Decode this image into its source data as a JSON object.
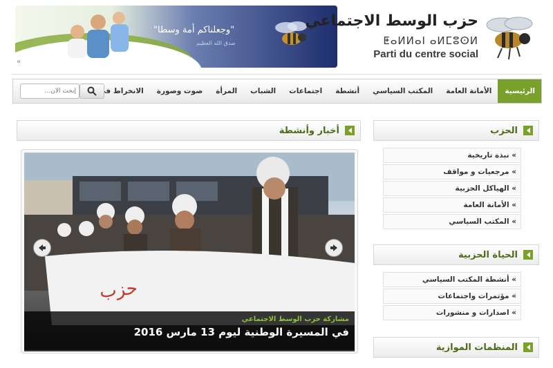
{
  "header": {
    "banner_quote": "\"وجعلناكم أمة وسطا\"",
    "banner_quote_source": "صدق الله العظيم",
    "banner_chevron": "«",
    "logo_arabic": "حزب الوسط الاجتماعي",
    "logo_tifinagh": "ⵟⴰⵍⵍⴰⵏ ⴰⵍⵎⵓⵙⵍ",
    "logo_french": "Parti du centre social"
  },
  "nav": {
    "items": [
      "الرئيسية",
      "الأمانة العامة",
      "المكتب السياسي",
      "أنشطة",
      "اجتماعات",
      "الشباب",
      "المرأة",
      "صوت وصورة",
      "الانخراط في الحزب"
    ],
    "active_index": 0,
    "search_placeholder": "إبحث الآن..."
  },
  "news": {
    "title": "أخبار وأنشطة",
    "slide_caption_small": "مشاركة حزب الوسط الاجتماعي",
    "slide_caption_big": "في المسيرة الوطنية ليوم 13 مارس 2016"
  },
  "sidebar": {
    "sections": [
      {
        "title": "الحزب",
        "items": [
          "» نبذة تاريخية",
          "» مرجعيات و مواقف",
          "» الهياكل الحزبية",
          "» الأمانة العامة",
          "» المكتب السياسي"
        ]
      },
      {
        "title": "الحياة الحزبية",
        "items": [
          "» أنشطة المكتب السياسي",
          "» مؤتمرات واجتماعات",
          "» اصدارات و منشورات"
        ]
      },
      {
        "title": "المنظمات الموازية",
        "items": []
      }
    ]
  },
  "colors": {
    "accent": "#79a02a",
    "heading": "#4d6b16"
  }
}
